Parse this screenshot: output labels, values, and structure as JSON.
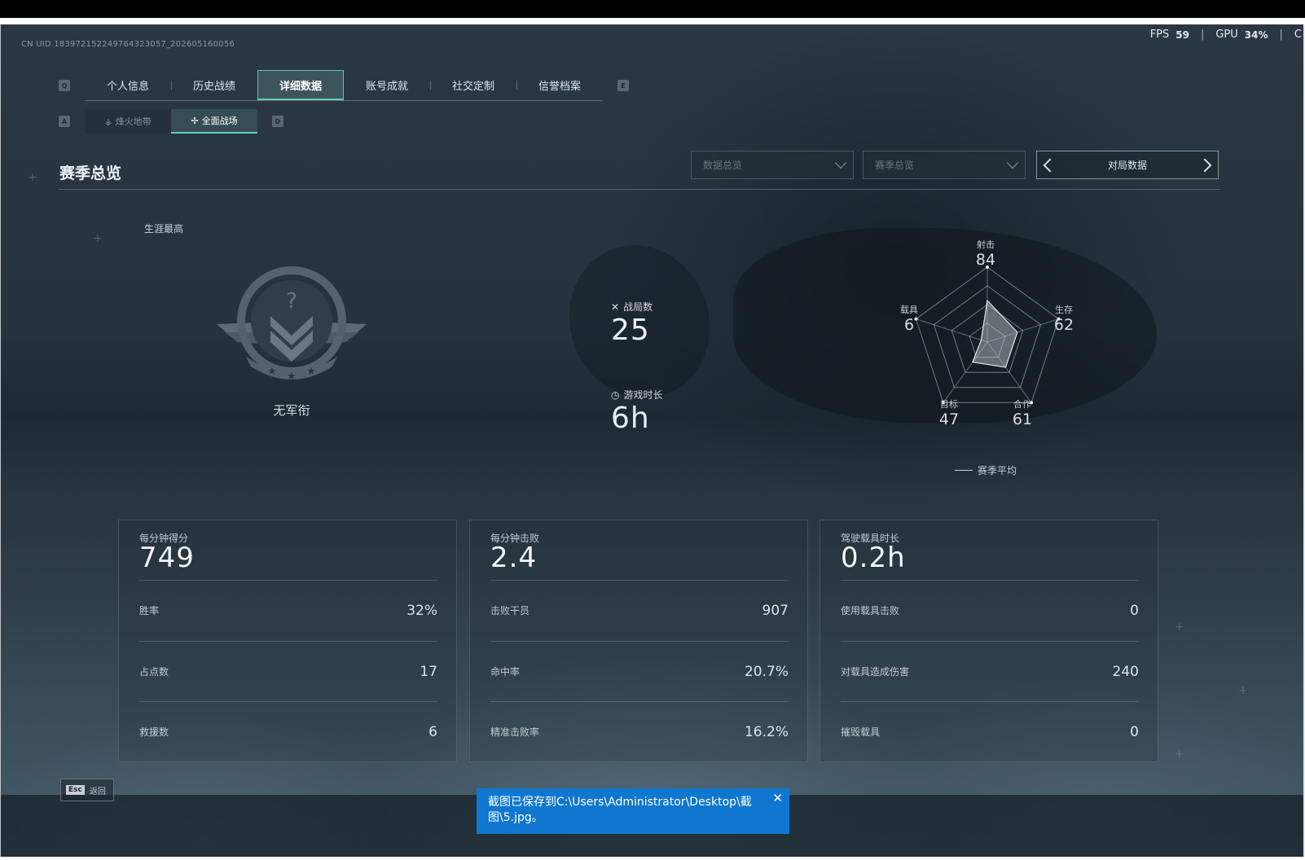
{
  "uid": "CN UID 183972152249764323057_202605160056",
  "perf": {
    "fps_label": "FPS",
    "fps_value": "59",
    "gpu_label": "GPU",
    "gpu_value": "34%",
    "trailing": "C"
  },
  "tabs": {
    "key_left": "Q",
    "key_right": "E",
    "items": [
      {
        "label": "个人信息"
      },
      {
        "label": "历史战绩"
      },
      {
        "label": "详细数据",
        "active": true
      },
      {
        "label": "账号成就"
      },
      {
        "label": "社交定制"
      },
      {
        "label": "信誉档案"
      }
    ]
  },
  "subtabs": {
    "key_left": "A",
    "key_right": "D",
    "items": [
      {
        "label": "烽火地带"
      },
      {
        "label": "全面战场",
        "active": true
      }
    ]
  },
  "section_title": "赛季总览",
  "filters": {
    "dropdown1": "数据总览",
    "dropdown2": "赛季总览",
    "match_nav": "对局数据"
  },
  "career": {
    "label": "生涯最高",
    "rank_name": "无军衔"
  },
  "stats": {
    "matches_label": "战局数",
    "matches_value": "25",
    "playtime_label": "游戏时长",
    "playtime_value": "6h"
  },
  "radar": {
    "axes": [
      {
        "label": "射击",
        "value": "84"
      },
      {
        "label": "生存",
        "value": "62"
      },
      {
        "label": "合作",
        "value": "61"
      },
      {
        "label": "目标",
        "value": "47"
      },
      {
        "label": "载具",
        "value": "6"
      }
    ],
    "legend": "赛季平均"
  },
  "cards": [
    {
      "head_label": "每分钟得分",
      "head_value": "749",
      "rows": [
        {
          "k": "胜率",
          "v": "32%"
        },
        {
          "k": "占点数",
          "v": "17"
        },
        {
          "k": "救援数",
          "v": "6"
        }
      ]
    },
    {
      "head_label": "每分钟击败",
      "head_value": "2.4",
      "rows": [
        {
          "k": "击败干员",
          "v": "907"
        },
        {
          "k": "命中率",
          "v": "20.7%"
        },
        {
          "k": "精准击败率",
          "v": "16.2%"
        }
      ]
    },
    {
      "head_label": "驾驶载具时长",
      "head_value": "0.2h",
      "rows": [
        {
          "k": "使用载具击败",
          "v": "0"
        },
        {
          "k": "对载具造成伤害",
          "v": "240"
        },
        {
          "k": "摧毁载具",
          "v": "0"
        }
      ]
    }
  ],
  "footer": {
    "esc_key": "Esc",
    "esc_label": "返回"
  },
  "toast": {
    "text": "截图已保存到C:\\Users\\Administrator\\Desktop\\截图\\5.jpg。",
    "close": "✕"
  }
}
